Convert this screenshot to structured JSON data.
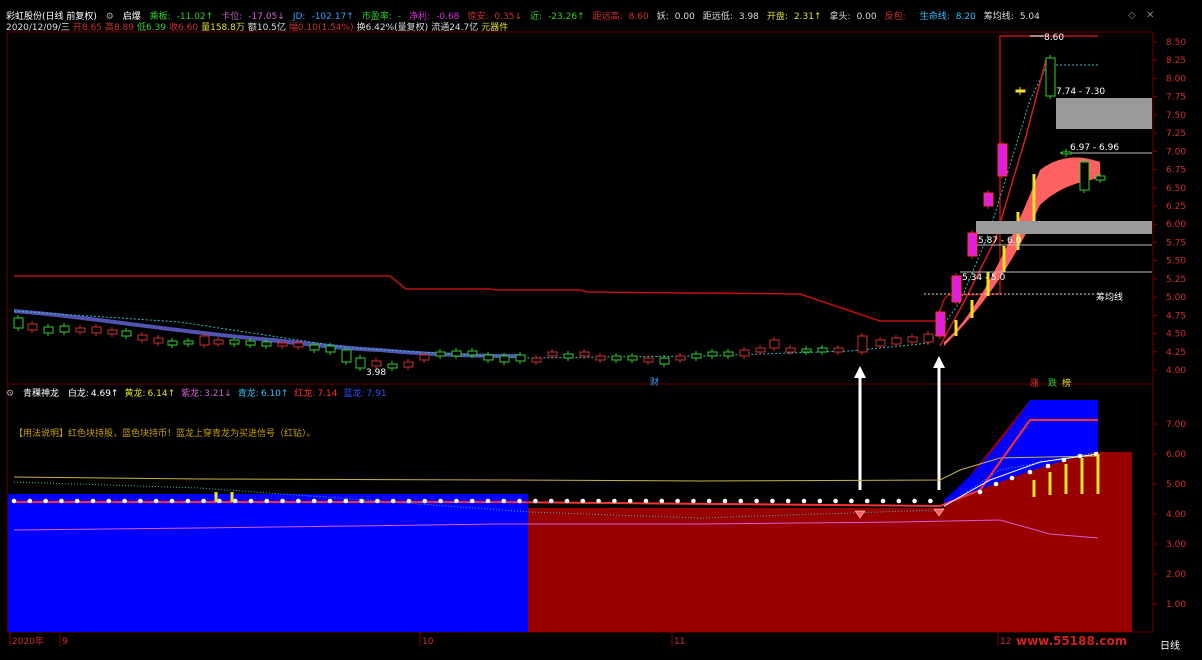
{
  "header": {
    "stock": "彩虹股份(日线 前复权)",
    "indicator": "启爆",
    "fields1": [
      {
        "label": "乘板:",
        "value": "-11.02↑",
        "color": "#30d030"
      },
      {
        "label": "卡位:",
        "value": "-17.05↓",
        "color": "#d060d0"
      },
      {
        "label": "JD:",
        "value": "-102.17↑",
        "color": "#30a0ff"
      },
      {
        "label": "市盈率:",
        "value": "-",
        "color": "#30d030"
      },
      {
        "label": "净利:",
        "value": "-0.68",
        "color": "#d030d0"
      },
      {
        "label": "惊安:",
        "value": "0.35↓",
        "color": "#d03030"
      },
      {
        "label": "近:",
        "value": "-23.26↑",
        "color": "#30d030"
      },
      {
        "label": "距远高:",
        "value": "8.60",
        "color": "#d03030"
      },
      {
        "label": "妖:",
        "value": "0.00",
        "color": "#ddd"
      },
      {
        "label": "距远低:",
        "value": "3.98",
        "color": "#ddd"
      },
      {
        "label": "开盘:",
        "value": "2.31↑",
        "color": "#e0e030"
      },
      {
        "label": "拿头:",
        "value": "0.00",
        "color": "#ddd"
      },
      {
        "label": "反包:",
        "value": "",
        "color": "#d03030"
      },
      {
        "label": "生命线:",
        "value": "8.20",
        "color": "#30c0ff"
      },
      {
        "label": "筹均线:",
        "value": "5.04",
        "color": "#ddd"
      }
    ],
    "fields2": [
      {
        "text": "2020/12/09/三",
        "color": "#ddd"
      },
      {
        "text": "开8.65",
        "color": "#d03030"
      },
      {
        "text": "高8.89",
        "color": "#d03030"
      },
      {
        "text": "低6.39",
        "color": "#30d030"
      },
      {
        "text": "收6.60",
        "color": "#d03030"
      },
      {
        "text": "量158.8万",
        "color": "#e0e030"
      },
      {
        "text": "额10.5亿",
        "color": "#ddd"
      },
      {
        "text": "幅0.10(1.54%)",
        "color": "#d03030"
      },
      {
        "text": "换6.42%(量复权)",
        "color": "#ddd"
      },
      {
        "text": "流通24.7亿",
        "color": "#ddd"
      },
      {
        "text": "元器件",
        "color": "#e0e030"
      }
    ]
  },
  "annotations": {
    "high_label": "8.60",
    "low_label": "3.98",
    "zone1": "7.74 - 7.30",
    "zone2": "6.97 - 6.96",
    "zone3": "5.87 - 6.0",
    "zone4": "5.34 - 5.0",
    "chip_line": "筹均线",
    "cai": "财"
  },
  "price_axis": [
    "8.50",
    "8.25",
    "8.00",
    "7.75",
    "7.50",
    "7.25",
    "7.00",
    "6.75",
    "6.50",
    "6.25",
    "6.00",
    "5.75",
    "5.50",
    "5.25",
    "5.00",
    "4.75",
    "4.50",
    "4.25",
    "4.00"
  ],
  "indicator_header": {
    "name": "青稞神龙",
    "items": [
      {
        "label": "白龙:",
        "value": "4.69↑",
        "color": "#ffffff"
      },
      {
        "label": "黄龙:",
        "value": "6.14↑",
        "color": "#e0e030"
      },
      {
        "label": "紫龙:",
        "value": "3.21↓",
        "color": "#d060d0"
      },
      {
        "label": "青龙:",
        "value": "6.10↑",
        "color": "#30c0ff"
      },
      {
        "label": "红龙:",
        "value": "7.14",
        "color": "#ff3030"
      },
      {
        "label": "蓝龙:",
        "value": "7.91",
        "color": "#3050ff"
      }
    ],
    "signals": [
      "涨",
      "跌",
      "榜"
    ]
  },
  "note": "【用法说明】红色块持股，蓝色块持币！蓝龙上穿青龙为买进信号（红钻）。",
  "indicator_axis": [
    "7.00",
    "6.00",
    "5.00",
    "4.00",
    "3.00",
    "2.00",
    "1.00"
  ],
  "time_axis": [
    "2020年",
    "9",
    "10",
    "11",
    "12"
  ],
  "period_label": "日线",
  "watermark": "www.55188.com"
}
